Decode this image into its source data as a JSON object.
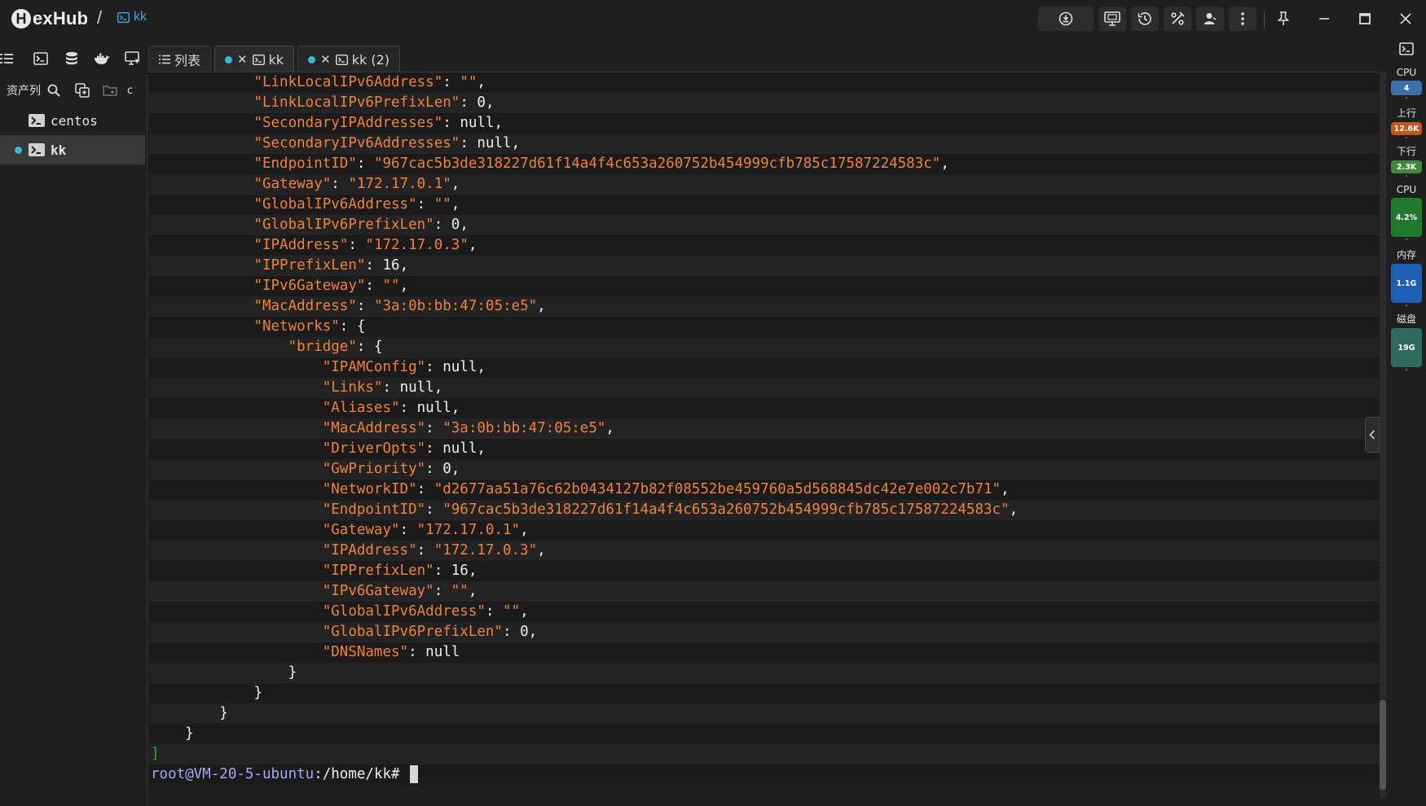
{
  "app": {
    "logo_letter": "H",
    "logo_text": "exHub",
    "breadcrumb_sep": "/",
    "breadcrumb_session": "kk"
  },
  "toolbar": {
    "icons": [
      "sync-icon",
      "monitor-icon",
      "history-icon",
      "percent-icon",
      "user-icon",
      "more-icon"
    ],
    "pin_icon": "pin-icon",
    "window": [
      "minimize-icon",
      "maximize-icon",
      "close-icon"
    ]
  },
  "icon_strip": [
    "list-icon",
    "terminal-icon",
    "database-icon",
    "docker-icon",
    "remote-desktop-icon"
  ],
  "tabs": [
    {
      "label": "列表",
      "active": false,
      "dot": false
    },
    {
      "label": "kk",
      "active": true,
      "dot": true
    },
    {
      "label": "kk (2)",
      "active": false,
      "dot": true
    }
  ],
  "sidebar": {
    "title": "资产列",
    "header_extra": "c",
    "items": [
      {
        "label": "centos",
        "selected": false,
        "online": false
      },
      {
        "label": "kk",
        "selected": true,
        "online": true
      }
    ]
  },
  "terminal": {
    "lines": [
      {
        "indent": "            ",
        "key": "\"LinkLocalIPv6Address\"",
        "val": "\"\"",
        "valtype": "s",
        "tail": ","
      },
      {
        "indent": "            ",
        "key": "\"LinkLocalIPv6PrefixLen\"",
        "val": "0",
        "valtype": "n",
        "tail": ","
      },
      {
        "indent": "            ",
        "key": "\"SecondaryIPAddresses\"",
        "val": "null",
        "valtype": "n",
        "tail": ","
      },
      {
        "indent": "            ",
        "key": "\"SecondaryIPv6Addresses\"",
        "val": "null",
        "valtype": "n",
        "tail": ","
      },
      {
        "indent": "            ",
        "key": "\"EndpointID\"",
        "val": "\"967cac5b3de318227d61f14a4f4c653a260752b454999cfb785c17587224583c\"",
        "valtype": "s",
        "tail": ","
      },
      {
        "indent": "            ",
        "key": "\"Gateway\"",
        "val": "\"172.17.0.1\"",
        "valtype": "s",
        "tail": ","
      },
      {
        "indent": "            ",
        "key": "\"GlobalIPv6Address\"",
        "val": "\"\"",
        "valtype": "s",
        "tail": ","
      },
      {
        "indent": "            ",
        "key": "\"GlobalIPv6PrefixLen\"",
        "val": "0",
        "valtype": "n",
        "tail": ","
      },
      {
        "indent": "            ",
        "key": "\"IPAddress\"",
        "val": "\"172.17.0.3\"",
        "valtype": "s",
        "tail": ","
      },
      {
        "indent": "            ",
        "key": "\"IPPrefixLen\"",
        "val": "16",
        "valtype": "n",
        "tail": ","
      },
      {
        "indent": "            ",
        "key": "\"IPv6Gateway\"",
        "val": "\"\"",
        "valtype": "s",
        "tail": ","
      },
      {
        "indent": "            ",
        "key": "\"MacAddress\"",
        "val": "\"3a:0b:bb:47:05:e5\"",
        "valtype": "s",
        "tail": ","
      },
      {
        "indent": "            ",
        "key": "\"Networks\"",
        "val": "{",
        "valtype": "n",
        "tail": ""
      },
      {
        "indent": "                ",
        "key": "\"bridge\"",
        "val": "{",
        "valtype": "n",
        "tail": ""
      },
      {
        "indent": "                    ",
        "key": "\"IPAMConfig\"",
        "val": "null",
        "valtype": "n",
        "tail": ","
      },
      {
        "indent": "                    ",
        "key": "\"Links\"",
        "val": "null",
        "valtype": "n",
        "tail": ","
      },
      {
        "indent": "                    ",
        "key": "\"Aliases\"",
        "val": "null",
        "valtype": "n",
        "tail": ","
      },
      {
        "indent": "                    ",
        "key": "\"MacAddress\"",
        "val": "\"3a:0b:bb:47:05:e5\"",
        "valtype": "s",
        "tail": ","
      },
      {
        "indent": "                    ",
        "key": "\"DriverOpts\"",
        "val": "null",
        "valtype": "n",
        "tail": ","
      },
      {
        "indent": "                    ",
        "key": "\"GwPriority\"",
        "val": "0",
        "valtype": "n",
        "tail": ","
      },
      {
        "indent": "                    ",
        "key": "\"NetworkID\"",
        "val": "\"d2677aa51a76c62b0434127b82f08552be459760a5d568845dc42e7e002c7b71\"",
        "valtype": "s",
        "tail": ","
      },
      {
        "indent": "                    ",
        "key": "\"EndpointID\"",
        "val": "\"967cac5b3de318227d61f14a4f4c653a260752b454999cfb785c17587224583c\"",
        "valtype": "s",
        "tail": ","
      },
      {
        "indent": "                    ",
        "key": "\"Gateway\"",
        "val": "\"172.17.0.1\"",
        "valtype": "s",
        "tail": ","
      },
      {
        "indent": "                    ",
        "key": "\"IPAddress\"",
        "val": "\"172.17.0.3\"",
        "valtype": "s",
        "tail": ","
      },
      {
        "indent": "                    ",
        "key": "\"IPPrefixLen\"",
        "val": "16",
        "valtype": "n",
        "tail": ","
      },
      {
        "indent": "                    ",
        "key": "\"IPv6Gateway\"",
        "val": "\"\"",
        "valtype": "s",
        "tail": ","
      },
      {
        "indent": "                    ",
        "key": "\"GlobalIPv6Address\"",
        "val": "\"\"",
        "valtype": "s",
        "tail": ","
      },
      {
        "indent": "                    ",
        "key": "\"GlobalIPv6PrefixLen\"",
        "val": "0",
        "valtype": "n",
        "tail": ","
      },
      {
        "indent": "                    ",
        "key": "\"DNSNames\"",
        "val": "null",
        "valtype": "n",
        "tail": ""
      },
      {
        "indent": "                ",
        "key": "",
        "val": "}",
        "valtype": "n",
        "tail": ""
      },
      {
        "indent": "            ",
        "key": "",
        "val": "}",
        "valtype": "n",
        "tail": ""
      },
      {
        "indent": "        ",
        "key": "",
        "val": "}",
        "valtype": "n",
        "tail": ""
      },
      {
        "indent": "    ",
        "key": "",
        "val": "}",
        "valtype": "n",
        "tail": ""
      }
    ],
    "closing_bracket": "]",
    "prompt_user": "root@VM-20-5-ubuntu",
    "prompt_path": ":/home/kk#"
  },
  "monitor": {
    "top_icon": "terminal-icon",
    "items": [
      {
        "label": "CPU",
        "value": "4",
        "color": "#3d6fb0"
      },
      {
        "label": "上行",
        "value": "12.6K",
        "color": "#c4561c"
      },
      {
        "label": "下行",
        "value": "2.3K",
        "color": "#3f8a3a"
      },
      {
        "label": "CPU",
        "value": "4.2%",
        "color": "#1f7a2e"
      },
      {
        "label": "内存",
        "value": "1.1G",
        "color": "#1c5fb3"
      },
      {
        "label": "磁盘",
        "value": "19G",
        "color": "#2e6b5e"
      }
    ]
  }
}
